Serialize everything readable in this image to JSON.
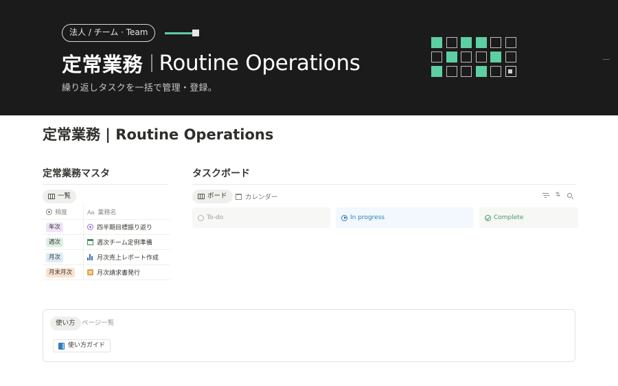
{
  "cover": {
    "tag": "法人 / チーム · Team",
    "title_jp": "定常業務",
    "title_en": "Routine Operations",
    "subtitle": "繰り返しタスクを一括で管理・登録。",
    "accent_color": "#5ecfa3",
    "grid": [
      [
        "on",
        "off",
        "on",
        "on",
        "off",
        "off"
      ],
      [
        "off",
        "on",
        "off",
        "off",
        "on",
        "off"
      ],
      [
        "on",
        "off",
        "off",
        "on",
        "off",
        "target"
      ]
    ]
  },
  "page": {
    "title": "定常業務 | Routine Operations"
  },
  "master": {
    "heading": "定常業務マスタ",
    "view_label": "一覧",
    "columns": {
      "frequency": "頻度",
      "name": "業務名",
      "name_prefix": "Aa"
    },
    "rows": [
      {
        "frequency": "年次",
        "tag_color": "#efe4f7",
        "icon": "target-icon",
        "name": "四半期目標振り返り"
      },
      {
        "frequency": "週次",
        "tag_color": "#dfefe6",
        "icon": "calendar-icon",
        "name": "週次チーム定例準備"
      },
      {
        "frequency": "月次",
        "tag_color": "#dcebf7",
        "icon": "bar-chart-icon",
        "name": "月次売上レポート作成"
      },
      {
        "frequency": "月末月次",
        "tag_color": "#f9e2d0",
        "icon": "invoice-icon",
        "name": "月次請求書発行"
      }
    ]
  },
  "board": {
    "heading": "タスクボード",
    "tabs": {
      "board": "ボード",
      "calendar": "カレンダー"
    },
    "columns": {
      "todo": "To-do",
      "in_progress": "In progress",
      "complete": "Complete"
    }
  },
  "usage": {
    "tab_active": "使い方",
    "tab_other": "ページ一覧",
    "guide_button": "使い方ガイド"
  }
}
